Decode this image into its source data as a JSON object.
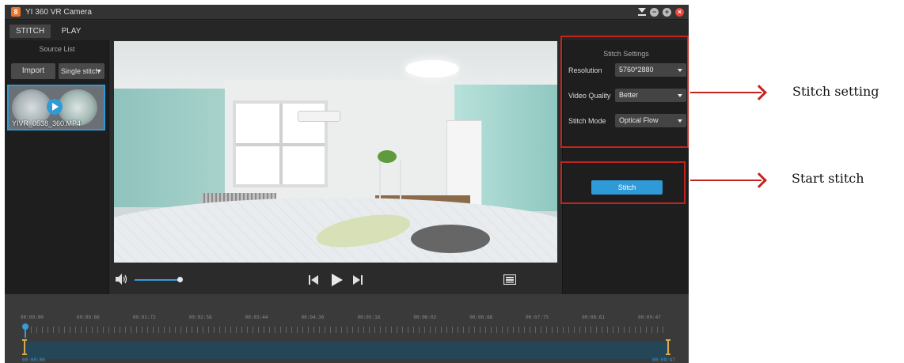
{
  "window": {
    "title": "YI 360 VR Camera",
    "logo": "8"
  },
  "tabs": [
    {
      "label": "STITCH",
      "active": true
    },
    {
      "label": "PLAY",
      "active": false
    }
  ],
  "source_list": {
    "title": "Source List",
    "import_label": "Import",
    "mode_value": "Single stitch",
    "items": [
      {
        "filename": "YIVR_0538_360.MP4",
        "selected": true
      }
    ]
  },
  "player": {
    "volume_fraction": 0.95
  },
  "stitch_settings": {
    "title": "Stitch Settings",
    "resolution_label": "Resolution",
    "resolution_value": "5760*2880",
    "quality_label": "Video Quality",
    "quality_value": "Better",
    "mode_label": "Stitch Mode",
    "mode_value": "Optical Flow",
    "stitch_button": "Stitch"
  },
  "timeline": {
    "labels": [
      "00:00:00",
      "00:00:86",
      "00:01:72",
      "00:02:58",
      "00:03:44",
      "00:04:30",
      "00:05:16",
      "00:06:02",
      "00:06:88",
      "00:07:75",
      "00:08:61",
      "00:09:47"
    ],
    "start_time": "00:00:00",
    "end_time": "00:09:47"
  },
  "annotations": {
    "settings_caption": "Stitch setting",
    "start_caption": "Start stitch",
    "color": "#c2251f"
  },
  "colors": {
    "accent": "#2e9ad8",
    "trim_handle": "#d9a948",
    "close_button": "#e8453c"
  }
}
